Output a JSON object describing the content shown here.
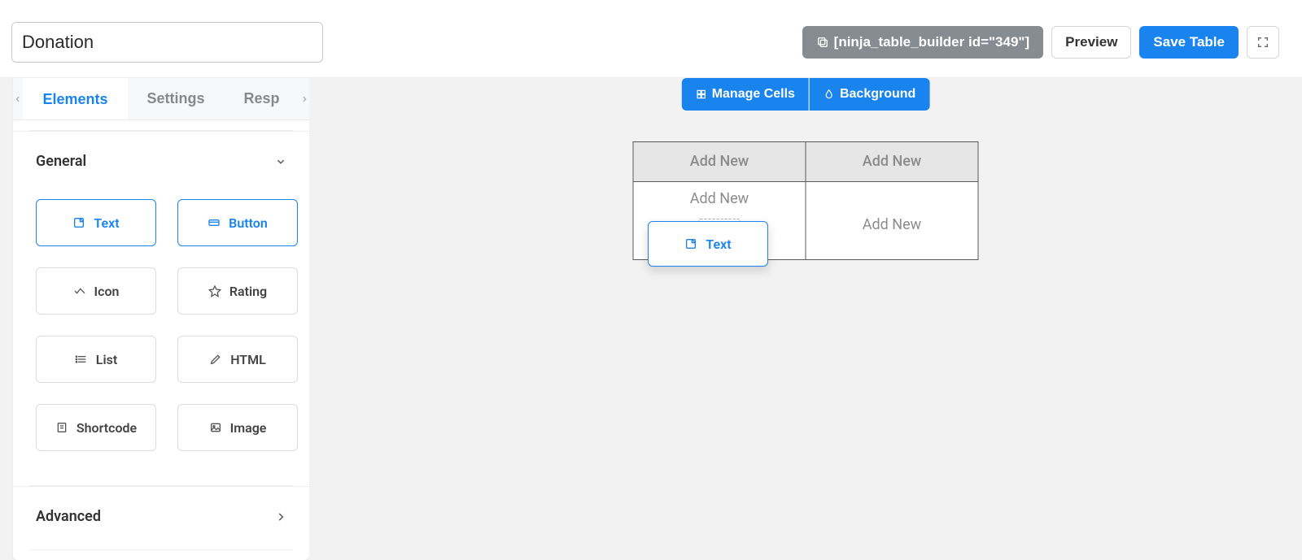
{
  "header": {
    "title_value": "Donation",
    "shortcode_label": "[ninja_table_builder id=\"349\"]",
    "preview_label": "Preview",
    "save_label": "Save Table"
  },
  "sidebar": {
    "tabs": {
      "elements": "Elements",
      "settings": "Settings",
      "responsive": "Resp"
    },
    "sections": {
      "general": "General",
      "advanced": "Advanced"
    },
    "elements": {
      "text": "Text",
      "button": "Button",
      "icon": "Icon",
      "rating": "Rating",
      "list": "List",
      "html": "HTML",
      "shortcode": "Shortcode",
      "image": "Image"
    }
  },
  "canvas": {
    "toolbar": {
      "manage_cells": "Manage Cells",
      "background": "Background"
    },
    "table": {
      "header": [
        "Add New",
        "Add New"
      ],
      "body_cell_1_label": "Add New",
      "body_cell_1_ghost": "Text",
      "body_cell_2_label": "Add New"
    },
    "drag_chip_label": "Text"
  },
  "colors": {
    "primary": "#1a84ee",
    "muted_btn": "#878c93"
  }
}
